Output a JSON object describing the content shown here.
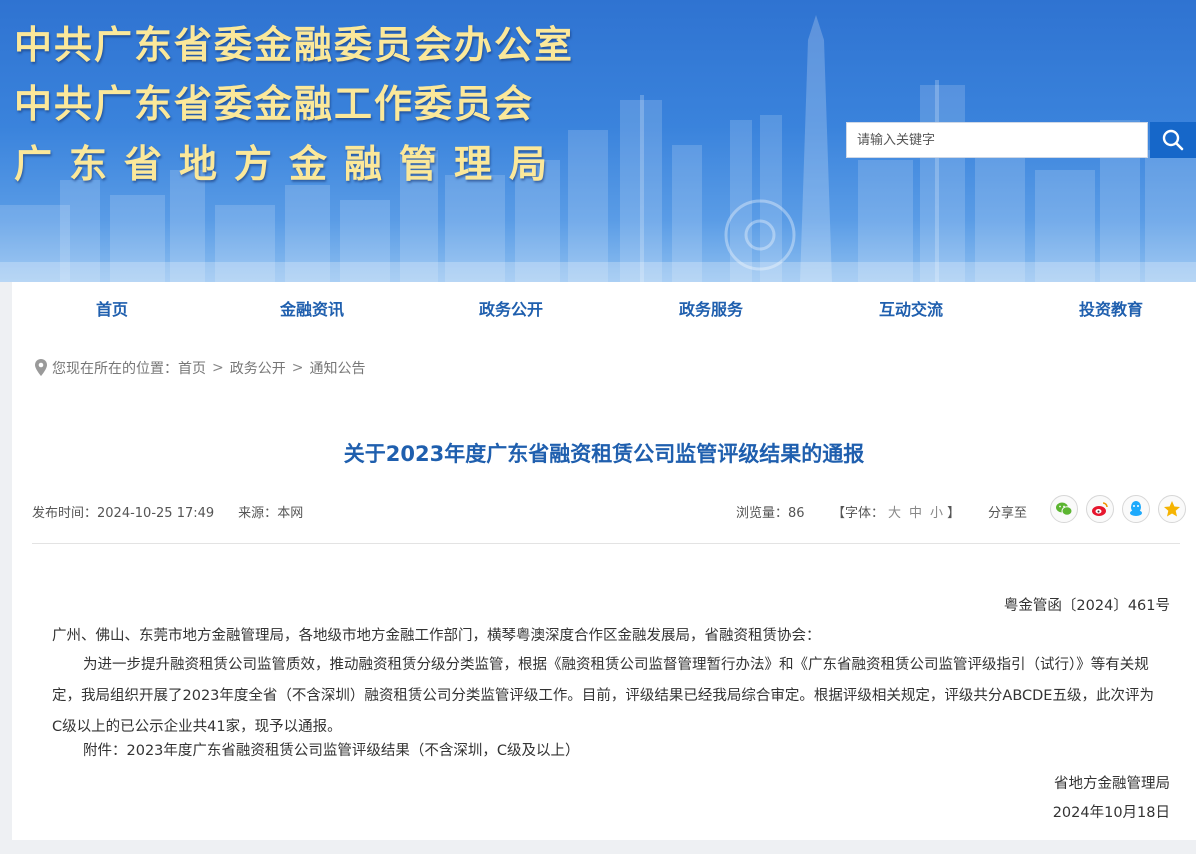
{
  "header": {
    "title_lines": [
      "中共广东省委金融委员会办公室",
      "中共广东省委金融工作委员会",
      "广东省地方金融管理局"
    ],
    "search_placeholder": "请输入关键字"
  },
  "nav": {
    "items": [
      "首页",
      "金融资讯",
      "政务公开",
      "政务服务",
      "互动交流",
      "投资教育"
    ]
  },
  "breadcrumb": {
    "prefix": "您现在所在的位置：",
    "items": [
      "首页",
      "政务公开",
      "通知公告"
    ],
    "separator": ">"
  },
  "article": {
    "title": "关于2023年度广东省融资租赁公司监管评级结果的通报",
    "publish_label": "发布时间：",
    "publish_time": "2024-10-25 17:49",
    "source_label": "来源：",
    "source": "本网",
    "views_label": "浏览量：",
    "views": "86",
    "font_label_open": "【字体：",
    "font_sizes": [
      "大",
      "中",
      "小"
    ],
    "font_label_close": "】",
    "share_label": "分享至",
    "doc_number": "粤金管函〔2024〕461号",
    "salutation": "广州、佛山、东莞市地方金融管理局，各地级市地方金融工作部门，横琴粤澳深度合作区金融发展局，省融资租赁协会：",
    "paragraph": "为进一步提升融资租赁公司监管质效，推动融资租赁分级分类监管，根据《融资租赁公司监督管理暂行办法》和《广东省融资租赁公司监管评级指引（试行）》等有关规定，我局组织开展了2023年度全省（不含深圳）融资租赁公司分类监管评级工作。目前，评级结果已经我局综合审定。根据评级相关规定，评级共分ABCDE五级，此次评为C级以上的已公示企业共41家，现予以通报。",
    "attachment": "附件：2023年度广东省融资租赁公司监管评级结果（不含深圳，C级及以上）",
    "signature": "省地方金融管理局",
    "date": "2024年10月18日"
  },
  "colors": {
    "banner": "#3a83dc",
    "title_gold": "#fbe89a",
    "nav_blue": "#1f5fae",
    "search_button": "#1667c9"
  },
  "icons": {
    "search": "search-icon",
    "location": "location-pin-icon",
    "share": [
      "wechat-icon",
      "weibo-icon",
      "qq-icon",
      "qzone-icon"
    ]
  }
}
